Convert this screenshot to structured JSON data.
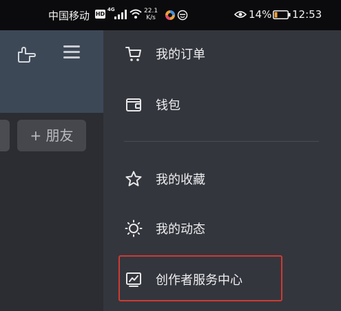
{
  "status_bar": {
    "carrier": "中国移动",
    "hd": "HD",
    "network": "4G",
    "speed_value": "22.1",
    "speed_unit": "K/s",
    "battery_percent": "14%",
    "time": "12:53"
  },
  "left_app": {
    "add_friend_label": "+ 朋友"
  },
  "drawer": {
    "items": [
      {
        "label": "我的订单",
        "icon": "cart-icon"
      },
      {
        "label": "钱包",
        "icon": "wallet-icon"
      },
      {
        "label": "我的收藏",
        "icon": "star-icon"
      },
      {
        "label": "我的动态",
        "icon": "sun-icon"
      },
      {
        "label": "创作者服务中心",
        "icon": "chart-icon"
      }
    ]
  },
  "colors": {
    "highlight_border": "#d03a33",
    "drawer_bg": "#34363d",
    "banner_bg": "#3d4857"
  }
}
